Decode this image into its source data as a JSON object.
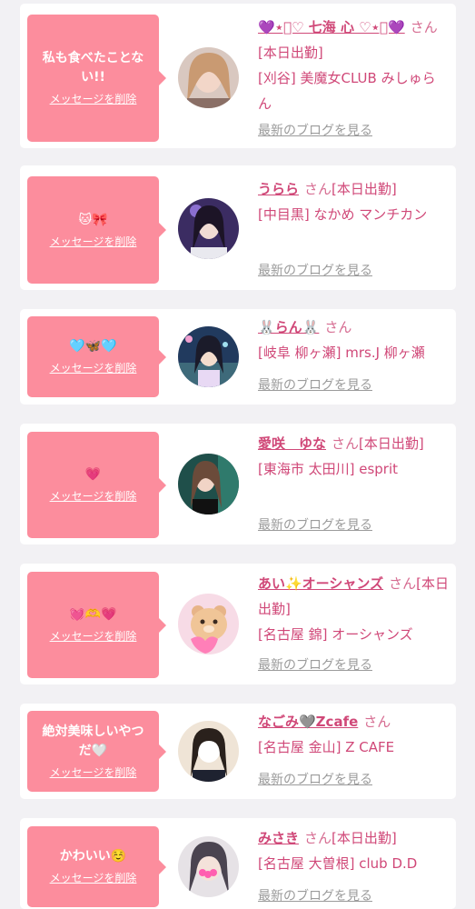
{
  "common": {
    "delete_label": "メッセージを削除",
    "blog_label": "最新のブログを見る",
    "san": "さん"
  },
  "colors": {
    "bubble": "#fc8d9d",
    "name": "#d04878",
    "link_gray": "#9b9b9b"
  },
  "entries": [
    {
      "message": "私も食べたことない!!",
      "name": "💜⋆͛♡ 七海 心 ♡⋆͛💜",
      "status": "[本日出勤]",
      "shop": "[刈谷] 美魔女CLUB みしゅらん"
    },
    {
      "message": "🐱🎀",
      "name": "うらら",
      "status": "[本日出勤]",
      "shop": "[中目黒] なかめ マンチカン"
    },
    {
      "message": "🩵🦋🩵",
      "name": "🐰らん🐰",
      "status": "",
      "shop": "[岐阜 柳ヶ瀬] mrs.J 柳ヶ瀬"
    },
    {
      "message": "💗",
      "name": "愛咲　ゆな",
      "status": "[本日出勤]",
      "shop": "[東海市 太田川] esprit"
    },
    {
      "message": "💓🫶💗",
      "name": "あい✨オーシャンズ",
      "status": "[本日出勤]",
      "shop": "[名古屋 錦] オーシャンズ"
    },
    {
      "message": "絶対美味しいやつだ🤍",
      "name": "なごみ🩶Zcafe",
      "status": "",
      "shop": "[名古屋 金山] Z CAFE"
    },
    {
      "message": "かわいい☺️",
      "name": "みさき",
      "status": "[本日出勤]",
      "shop": "[名古屋 大曽根] club D.D"
    }
  ]
}
